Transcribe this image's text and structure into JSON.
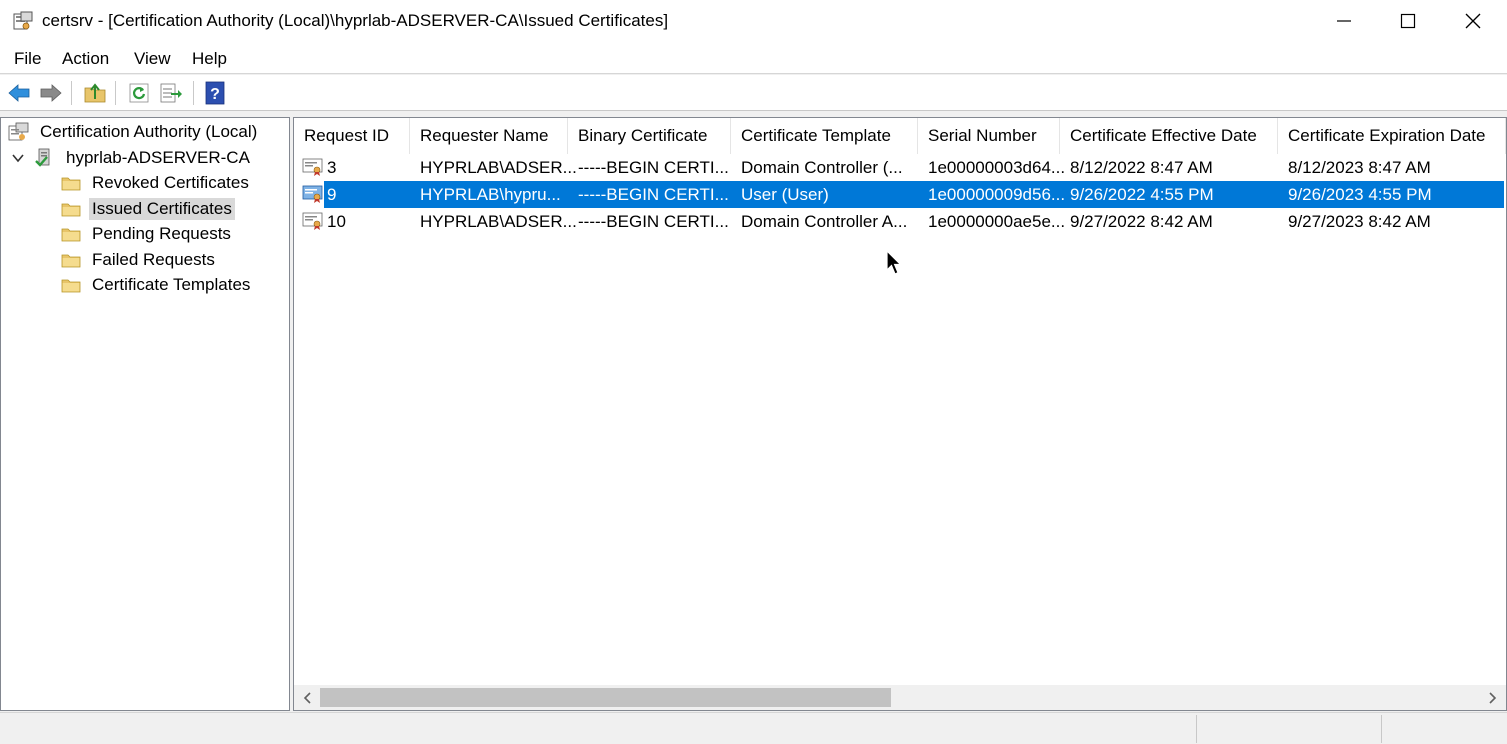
{
  "window": {
    "title": "certsrv - [Certification Authority (Local)\\hyprlab-ADSERVER-CA\\Issued Certificates]",
    "app_icon": "certsrv-icon",
    "controls": [
      "minimize-icon",
      "maximize-icon",
      "close-icon"
    ]
  },
  "menu": {
    "items": [
      "File",
      "Action",
      "View",
      "Help"
    ]
  },
  "toolbar": {
    "buttons": [
      "back-arrow-icon",
      "forward-arrow-icon",
      "up-folder-icon",
      "refresh-icon",
      "export-list-icon",
      "help-icon"
    ]
  },
  "tree": {
    "root": "Certification Authority (Local)",
    "ca": "hyprlab-ADSERVER-CA",
    "folders": [
      "Revoked Certificates",
      "Issued Certificates",
      "Pending Requests",
      "Failed Requests",
      "Certificate Templates"
    ],
    "selected": "Issued Certificates"
  },
  "table": {
    "columns": [
      "Request ID",
      "Requester Name",
      "Binary Certificate",
      "Certificate Template",
      "Serial Number",
      "Certificate Effective Date",
      "Certificate Expiration Date"
    ],
    "rows": [
      {
        "id": "3",
        "requester": "HYPRLAB\\ADSER...",
        "binary": "-----BEGIN CERTI...",
        "template": "Domain Controller (...",
        "serial": "1e00000003d64...",
        "effective": "8/12/2022 8:47 AM",
        "expiration": "8/12/2023 8:47 AM"
      },
      {
        "id": "9",
        "requester": "HYPRLAB\\hypru...",
        "binary": "-----BEGIN CERTI...",
        "template": "User (User)",
        "serial": "1e00000009d56...",
        "effective": "9/26/2022 4:55 PM",
        "expiration": "9/26/2023 4:55 PM"
      },
      {
        "id": "10",
        "requester": "HYPRLAB\\ADSER...",
        "binary": "-----BEGIN CERTI...",
        "template": "Domain Controller A...",
        "serial": "1e0000000ae5e...",
        "effective": "9/27/2022 8:42 AM",
        "expiration": "9/27/2023 8:42 AM"
      }
    ],
    "selected_row": "9"
  },
  "colors": {
    "selection": "#0078d7",
    "tree_selection": "#d9d9d9",
    "folder": "#e8c56a"
  }
}
